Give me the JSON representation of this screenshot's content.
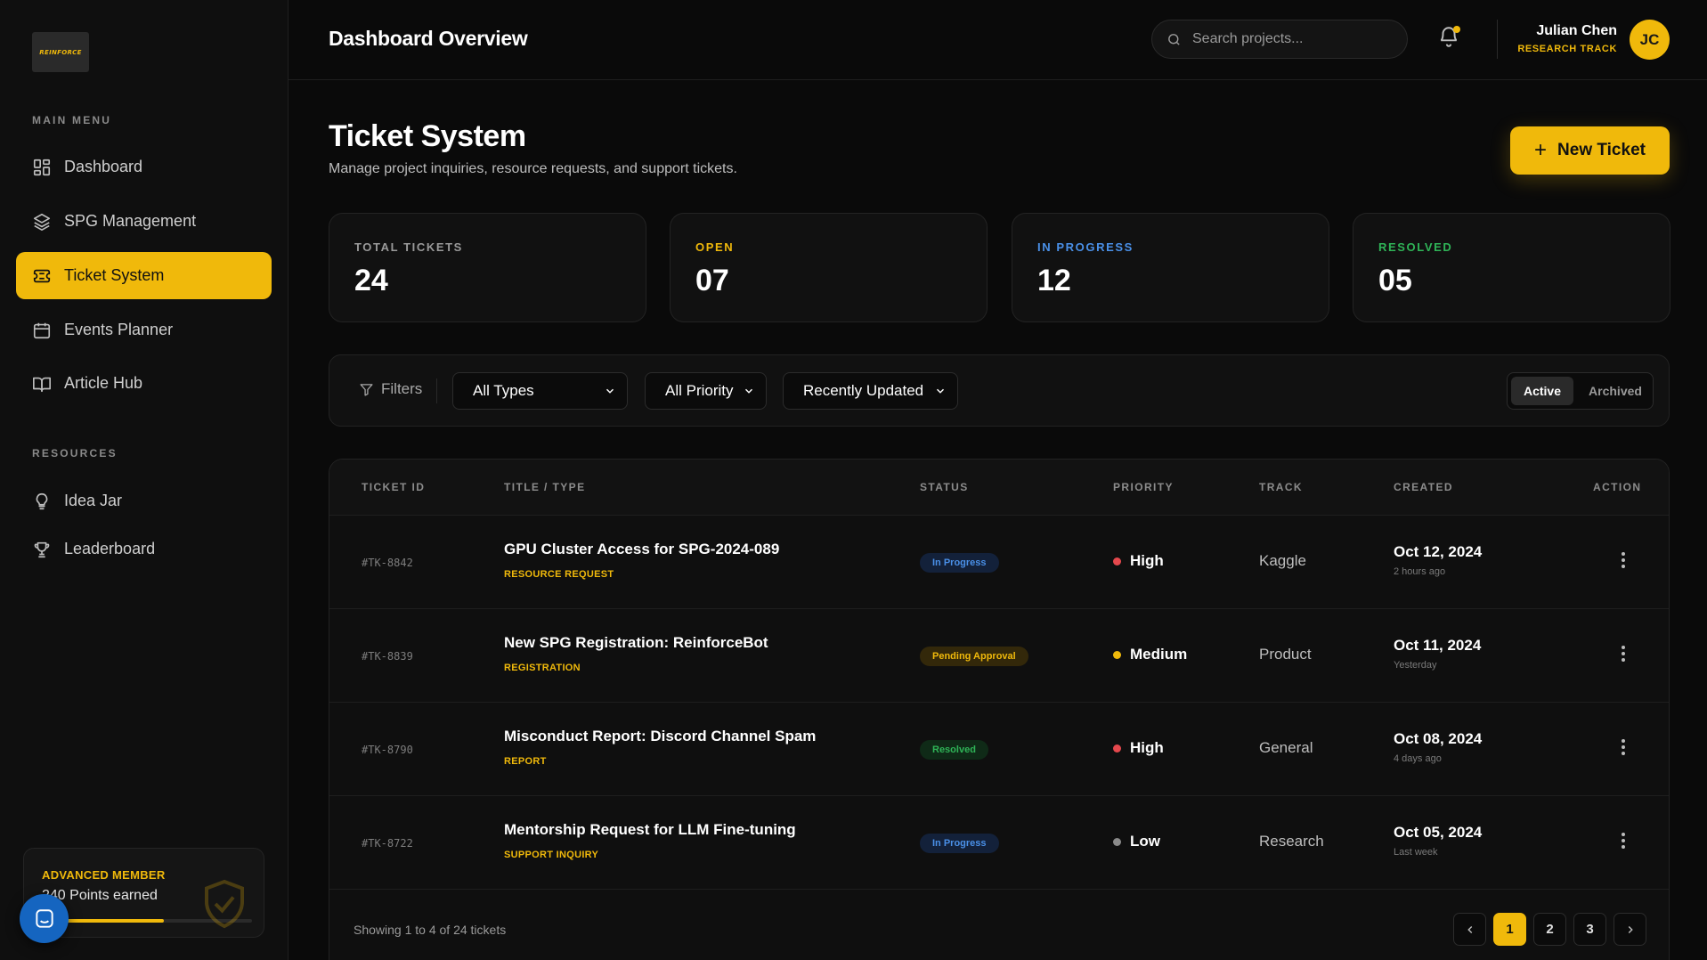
{
  "brand": {
    "logo_text": "REINFORCE"
  },
  "sidebar": {
    "main_menu_label": "MAIN MENU",
    "resources_label": "RESOURCES",
    "items": [
      {
        "label": "Dashboard",
        "icon": "dashboard-grid-icon"
      },
      {
        "label": "SPG Management",
        "icon": "layers-icon"
      },
      {
        "label": "Ticket System",
        "icon": "ticket-icon",
        "active": true
      },
      {
        "label": "Events Planner",
        "icon": "calendar-icon"
      },
      {
        "label": "Article Hub",
        "icon": "book-icon"
      }
    ],
    "resources": [
      {
        "label": "Idea Jar",
        "icon": "lightbulb-icon"
      },
      {
        "label": "Leaderboard",
        "icon": "trophy-icon"
      }
    ],
    "member": {
      "title": "ADVANCED MEMBER",
      "points_text": "240 Points earned",
      "progress": 0.58
    }
  },
  "header": {
    "title": "Dashboard Overview",
    "search_placeholder": "Search projects...",
    "user_name": "Julian Chen",
    "user_track": "RESEARCH TRACK",
    "avatar_initials": "JC"
  },
  "page": {
    "title": "Ticket System",
    "subtitle": "Manage project inquiries, resource requests, and support tickets.",
    "new_ticket_label": "New Ticket"
  },
  "stats": [
    {
      "label": "TOTAL TICKETS",
      "value": "24",
      "color": "#9a9a9a"
    },
    {
      "label": "OPEN",
      "value": "07",
      "color": "#f0b90b"
    },
    {
      "label": "IN PROGRESS",
      "value": "12",
      "color": "#4a90e8"
    },
    {
      "label": "RESOLVED",
      "value": "05",
      "color": "#2fb457"
    }
  ],
  "filters": {
    "label": "Filters",
    "type_value": "All Types",
    "priority_value": "All Priority",
    "sort_value": "Recently Updated",
    "toggle_active": "Active",
    "toggle_inactive": "Archived"
  },
  "table": {
    "columns": [
      "TICKET ID",
      "TITLE / TYPE",
      "STATUS",
      "PRIORITY",
      "TRACK",
      "CREATED",
      "ACTION"
    ],
    "rows": [
      {
        "id": "#TK-8842",
        "title": "GPU Cluster Access for SPG-2024-089",
        "type": "RESOURCE REQUEST",
        "status": "In Progress",
        "status_kind": "progress",
        "priority": "High",
        "priority_color": "#e5484d",
        "track": "Kaggle",
        "created": "Oct 12, 2024",
        "created_rel": "2 hours ago"
      },
      {
        "id": "#TK-8839",
        "title": "New SPG Registration: ReinforceBot",
        "type": "REGISTRATION",
        "status": "Pending Approval",
        "status_kind": "pending",
        "priority": "Medium",
        "priority_color": "#f0b90b",
        "track": "Product",
        "created": "Oct 11, 2024",
        "created_rel": "Yesterday"
      },
      {
        "id": "#TK-8790",
        "title": "Misconduct Report: Discord Channel Spam",
        "type": "REPORT",
        "status": "Resolved",
        "status_kind": "resolved",
        "priority": "High",
        "priority_color": "#e5484d",
        "track": "General",
        "created": "Oct 08, 2024",
        "created_rel": "4 days ago"
      },
      {
        "id": "#TK-8722",
        "title": "Mentorship Request for LLM Fine-tuning",
        "type": "SUPPORT INQUIRY",
        "status": "In Progress",
        "status_kind": "progress",
        "priority": "Low",
        "priority_color": "#8a8a8a",
        "track": "Research",
        "created": "Oct 05, 2024",
        "created_rel": "Last week"
      }
    ],
    "footer_text": "Showing 1 to 4 of 24 tickets",
    "pages": [
      "1",
      "2",
      "3"
    ],
    "current_page": "1"
  }
}
